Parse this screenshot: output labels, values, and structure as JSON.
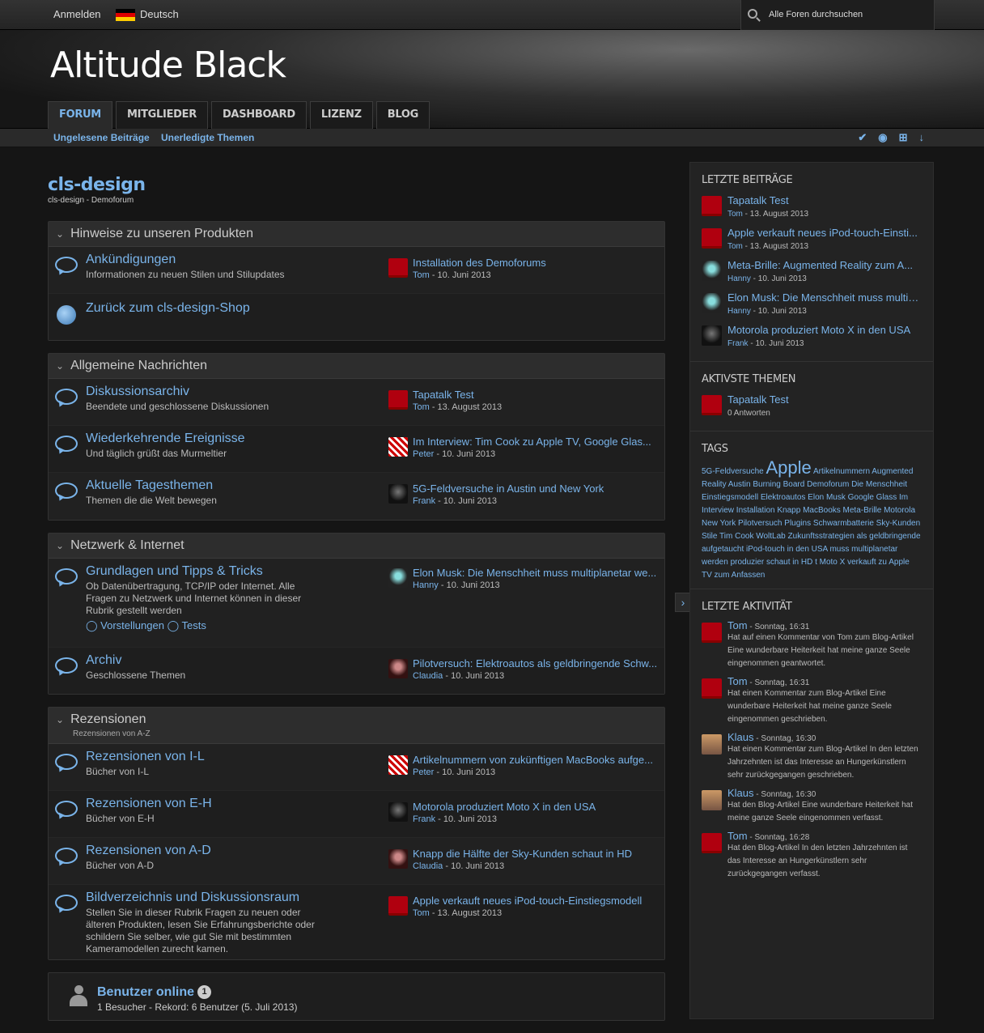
{
  "topbar": {
    "login": "Anmelden",
    "language": "Deutsch",
    "search_label": "Alle Foren durchsuchen"
  },
  "header": {
    "title": "Altitude Black"
  },
  "tabs": [
    "FORUM",
    "MITGLIEDER",
    "DASHBOARD",
    "LIZENZ",
    "BLOG"
  ],
  "subnav": {
    "unread": "Ungelesene Beiträge",
    "unresolved": "Unerledigte Themen"
  },
  "page": {
    "title": "cls-design",
    "breadcrumb": "cls-design - Demoforum"
  },
  "categories": [
    {
      "title": "Hinweise zu unseren Produkten",
      "forums": [
        {
          "title": "Ankündigungen",
          "desc": "Informationen zu neuen Stilen und Stilupdates",
          "last_title": "Installation des Demoforums",
          "last_user": "Tom",
          "last_date": " - 10. Juni 2013"
        },
        {
          "title": "Zurück zum cls-design-Shop"
        }
      ]
    },
    {
      "title": "Allgemeine Nachrichten",
      "forums": [
        {
          "title": "Diskussionsarchiv",
          "desc": "Beendete und geschlossene Diskussionen",
          "last_title": "Tapatalk Test",
          "last_user": "Tom",
          "last_date": " - 13. August 2013"
        },
        {
          "title": "Wiederkehrende Ereignisse",
          "desc": "Und täglich grüßt das Murmeltier",
          "last_title": "Im Interview: Tim Cook zu Apple TV, Google Glas...",
          "last_user": "Peter",
          "last_date": " - 10. Juni 2013"
        },
        {
          "title": "Aktuelle Tagesthemen",
          "desc": "Themen die die Welt bewegen",
          "last_title": "5G-Feldversuche in Austin und New York",
          "last_user": "Frank",
          "last_date": " - 10. Juni 2013"
        }
      ]
    },
    {
      "title": "Netzwerk & Internet",
      "forums": [
        {
          "title": "Grundlagen und Tipps & Tricks",
          "desc": "Ob Datenübertragung, TCP/IP oder Internet. Alle Fragen zu Netzwerk und Internet können in dieser Rubrik gestellt werden",
          "sub1": "Vorstellungen",
          "sub2": "Tests",
          "last_title": "Elon Musk: Die Menschheit muss multiplanetar we...",
          "last_user": "Hanny",
          "last_date": " - 10. Juni 2013"
        },
        {
          "title": "Archiv",
          "desc": "Geschlossene Themen",
          "last_title": "Pilotversuch: Elektroautos als geldbringende Schw...",
          "last_user": "Claudia",
          "last_date": " - 10. Juni 2013"
        }
      ]
    },
    {
      "title": "Rezensionen",
      "desc": "Rezensionen von A-Z",
      "forums": [
        {
          "title": "Rezensionen von I-L",
          "desc": "Bücher von I-L",
          "last_title": "Artikelnummern von zukünftigen MacBooks aufge...",
          "last_user": "Peter",
          "last_date": " - 10. Juni 2013"
        },
        {
          "title": "Rezensionen von E-H",
          "desc": "Bücher von E-H",
          "last_title": "Motorola produziert Moto X in den USA",
          "last_user": "Frank",
          "last_date": " - 10. Juni 2013"
        },
        {
          "title": "Rezensionen von A-D",
          "desc": "Bücher von A-D",
          "last_title": "Knapp die Hälfte der Sky-Kunden schaut in HD",
          "last_user": "Claudia",
          "last_date": " - 10. Juni 2013"
        },
        {
          "title": "Bildverzeichnis und Diskussionsraum",
          "desc": "Stellen Sie in dieser Rubrik Fragen zu neuen oder älteren Produkten, lesen Sie Erfahrungsberichte oder schildern Sie selber, wie gut Sie mit bestimmten Kameramodellen zurecht kamen.",
          "last_title": "Apple verkauft neues iPod-touch-Einstiegsmodell",
          "last_user": "Tom",
          "last_date": " - 13. August 2013"
        }
      ]
    }
  ],
  "online": {
    "title": "Benutzer online",
    "count": "1",
    "desc": "1 Besucher - Rekord: 6 Benutzer (5. Juli 2013)"
  },
  "sidebar": {
    "recent_title": "LETZTE BEITRÄGE",
    "recent": [
      {
        "title": "Tapatalk Test",
        "user": "Tom",
        "date": " - 13. August 2013"
      },
      {
        "title": "Apple verkauft neues iPod-touch-Einsti...",
        "user": "Tom",
        "date": " - 13. August 2013"
      },
      {
        "title": "Meta-Brille: Augmented Reality zum A...",
        "user": "Hanny",
        "date": " - 10. Juni 2013"
      },
      {
        "title": "Elon Musk: Die Menschheit muss multip...",
        "user": "Hanny",
        "date": " - 10. Juni 2013"
      },
      {
        "title": "Motorola produziert Moto X in den USA",
        "user": "Frank",
        "date": " - 10. Juni 2013"
      }
    ],
    "active_title": "AKTIVSTE THEMEN",
    "active": {
      "title": "Tapatalk Test",
      "meta": "0 Antworten"
    },
    "tags_title": "TAGS",
    "tags_pre": "5G-Feldversuche",
    "tags_big": "Apple",
    "tags_rest": "Artikelnummern Augmented Reality Austin Burning Board Demoforum Die Menschheit Einstiegsmodell Elektroautos Elon Musk Google Glass Im Interview Installation Knapp MacBooks Meta-Brille Motorola New York Pilotversuch Plugins Schwarmbatterie Sky-Kunden Stile Tim Cook WoltLab Zukunftsstrategien als geldbringende aufgetaucht iPod-touch in den USA muss multiplanetar werden produzier schaut in HD t Moto X verkauft zu Apple TV zum Anfassen",
    "activity_title": "LETZTE AKTIVITÄT",
    "activity": [
      {
        "user": "Tom",
        "time": " - Sonntag, 16:31",
        "text": "Hat auf einen Kommentar von Tom zum Blog-Artikel Eine wunderbare Heiterkeit hat meine ganze Seele eingenommen geantwortet."
      },
      {
        "user": "Tom",
        "time": " - Sonntag, 16:31",
        "text": "Hat einen Kommentar zum Blog-Artikel Eine wunderbare Heiterkeit hat meine ganze Seele eingenommen geschrieben."
      },
      {
        "user": "Klaus",
        "time": " - Sonntag, 16:30",
        "text": "Hat einen Kommentar zum Blog-Artikel In den letzten Jahrzehnten ist das Interesse an Hungerkünstlern sehr zurückgegangen geschrieben."
      },
      {
        "user": "Klaus",
        "time": " - Sonntag, 16:30",
        "text": "Hat den Blog-Artikel Eine wunderbare Heiterkeit hat meine ganze Seele eingenommen verfasst."
      },
      {
        "user": "Tom",
        "time": " - Sonntag, 16:28",
        "text": "Hat den Blog-Artikel In den letzten Jahrzehnten ist das Interesse an Hungerkünstlern sehr zurückgegangen verfasst."
      }
    ]
  }
}
